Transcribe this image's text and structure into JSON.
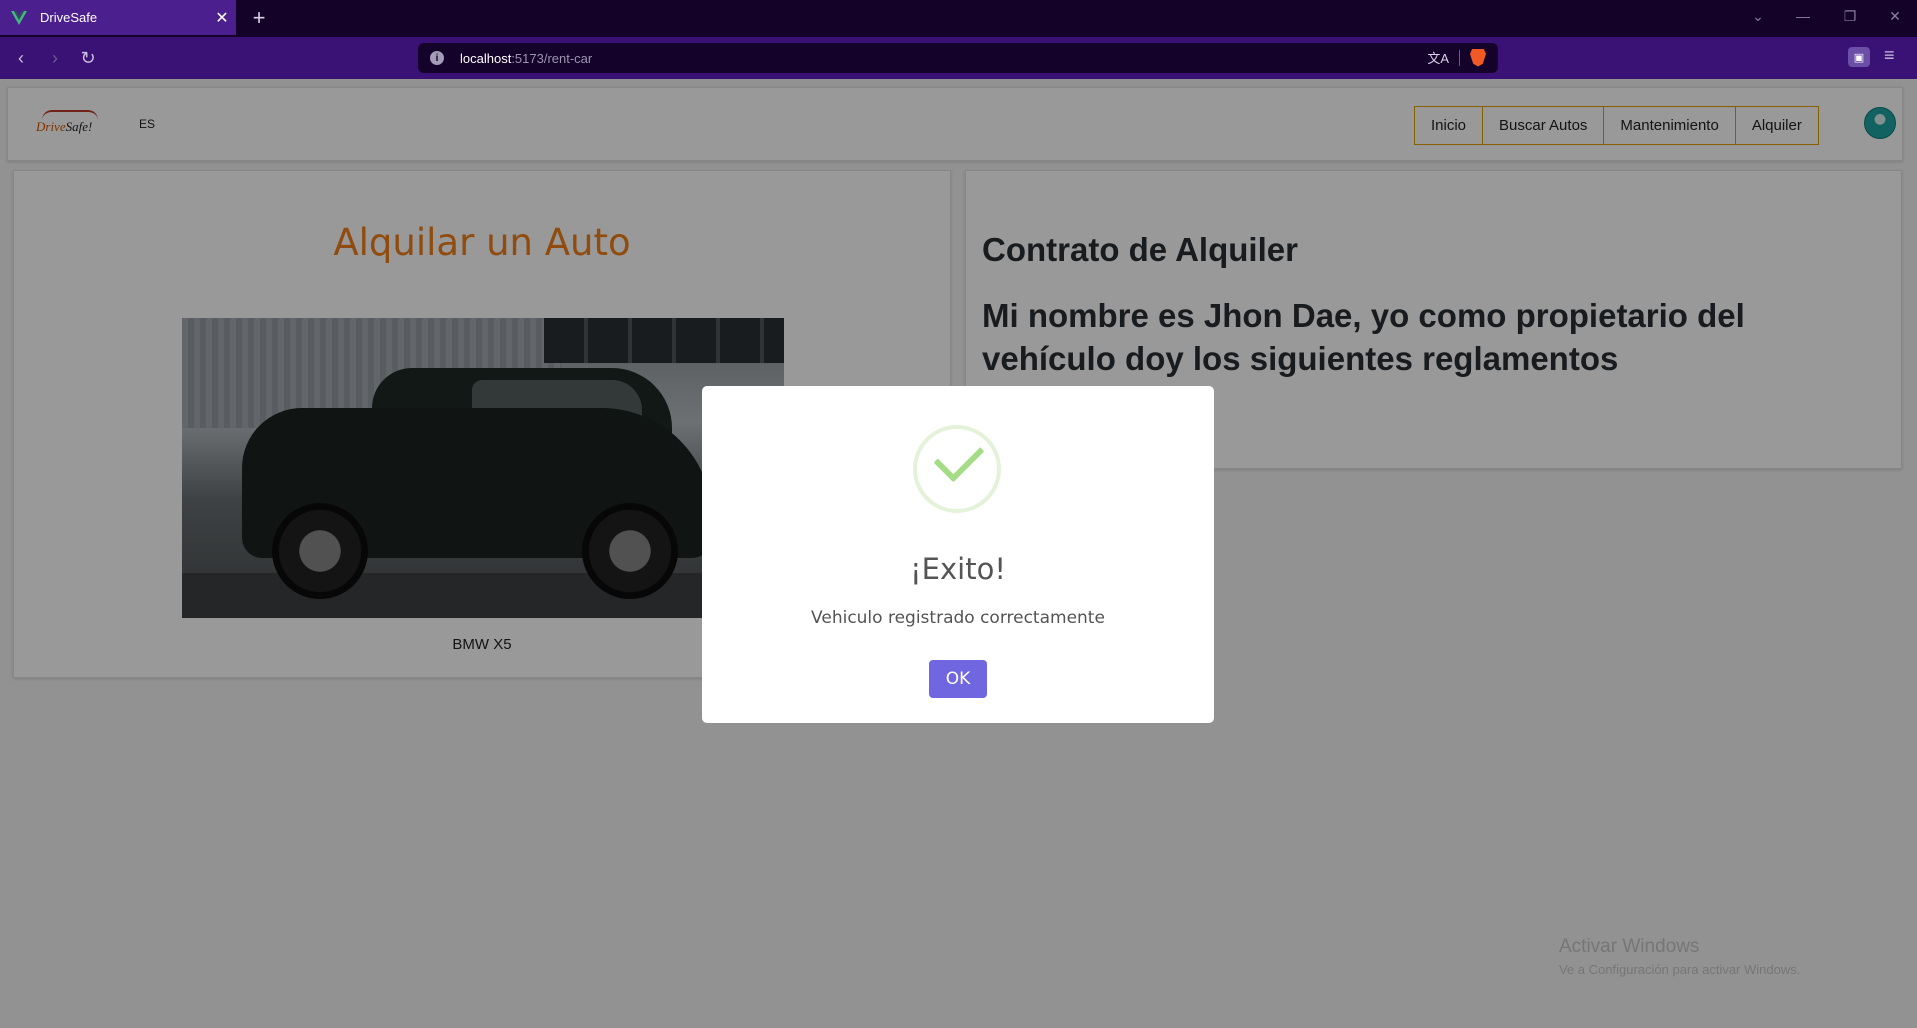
{
  "browser": {
    "tab_title": "DriveSafe",
    "tab_close": "✕",
    "new_tab": "+",
    "url_host": "localhost",
    "url_path": ":5173/rent-car",
    "translate_glyph": "文A"
  },
  "navbar": {
    "logo_drive": "Drive",
    "logo_safe": "Safe!",
    "lang": "ES",
    "links": [
      "Inicio",
      "Buscar Autos",
      "Mantenimiento",
      "Alquiler"
    ]
  },
  "rent": {
    "title": "Alquilar un Auto",
    "car_name": "BMW X5"
  },
  "contract": {
    "heading": "Contrato de Alquiler",
    "statement": "Mi nombre es Jhon Dae, yo como propietario del vehículo doy los siguientes reglamentos"
  },
  "modal": {
    "title": "¡Exito!",
    "message": "Vehiculo registrado correctamente",
    "ok_label": "OK"
  },
  "watermark": {
    "line1": "Activar Windows",
    "line2": "Ve a Configuración para activar Windows."
  },
  "colors": {
    "accent_orange": "#f07f1a",
    "nav_border": "#e0a100",
    "ok_button": "#7066e0",
    "success_check": "#a5dc86",
    "browser_toolbar": "#3a1275"
  }
}
